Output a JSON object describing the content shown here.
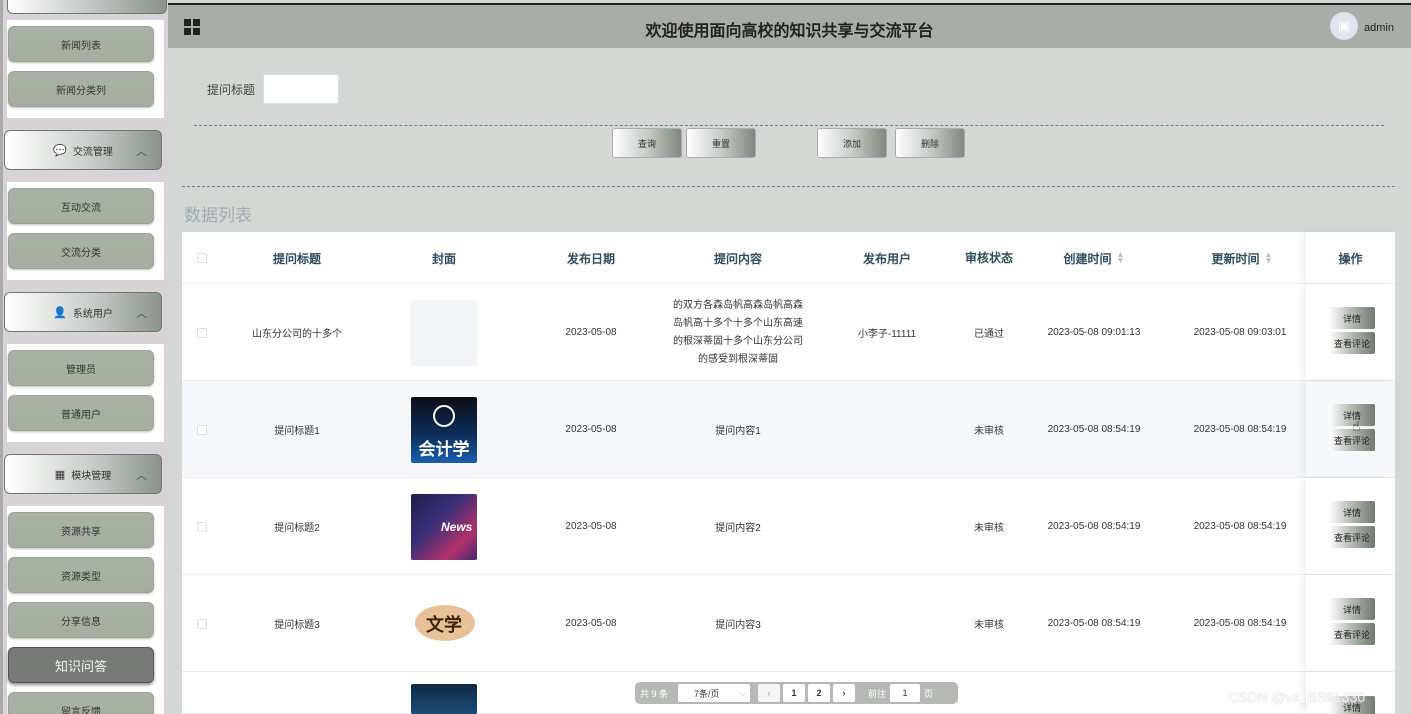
{
  "sidebar": {
    "top_items": [
      "新闻列表",
      "新闻分类列"
    ],
    "groups": [
      {
        "header": "交流管理",
        "items": [
          "互动交流",
          "交流分类"
        ]
      },
      {
        "header": "系统用户",
        "items": [
          "管理员",
          "普通用户"
        ]
      },
      {
        "header": "模块管理",
        "items": [
          "资源共享",
          "资源类型",
          "分享信息",
          "知识问答",
          "留言反馈"
        ]
      }
    ],
    "active_item": "知识问答"
  },
  "topbar": {
    "title": "欢迎使用面向高校的知识共享与交流平台",
    "user": "admin"
  },
  "search": {
    "label": "提问标题",
    "value": ""
  },
  "actions": {
    "query": "查询",
    "reset": "重置",
    "add": "添加",
    "delete": "删除"
  },
  "list_title": "数据列表",
  "table": {
    "headers": [
      "提问标题",
      "封面",
      "发布日期",
      "提问内容",
      "发布用户",
      "审核状态",
      "创建时间",
      "更新时间",
      "操作"
    ],
    "rows": [
      {
        "title": "山东分公司的十多个",
        "cover": "blank",
        "date": "2023-05-08",
        "content": "的双方各森岛帆高森岛帆高森岛帆高十多个十多个山东高速的根深蒂固十多个山东分公司的感受到根深蒂固",
        "user": "小李子-11111",
        "status": "已通过",
        "created": "2023-05-08 09:01:13",
        "updated": "2023-05-08 09:03:01"
      },
      {
        "title": "提问标题1",
        "cover": "accounting",
        "cover_text": "会计学",
        "date": "2023-05-08",
        "content": "提问内容1",
        "user": "",
        "status": "未审核",
        "created": "2023-05-08 08:54:19",
        "updated": "2023-05-08 08:54:19"
      },
      {
        "title": "提问标题2",
        "cover": "news",
        "cover_text": "News",
        "date": "2023-05-08",
        "content": "提问内容2",
        "user": "",
        "status": "未审核",
        "created": "2023-05-08 08:54:19",
        "updated": "2023-05-08 08:54:19"
      },
      {
        "title": "提问标题3",
        "cover": "literature",
        "cover_text": "文学",
        "date": "2023-05-08",
        "content": "提问内容3",
        "user": "",
        "status": "未审核",
        "created": "2023-05-08 08:54:19",
        "updated": "2023-05-08 08:54:19"
      }
    ],
    "row_buttons": {
      "detail": "详情",
      "comments": "查看评论"
    }
  },
  "pagination": {
    "total": "共 9 条",
    "page_size": "7条/页",
    "pages": [
      "1",
      "2"
    ],
    "goto_label": "前往",
    "goto_value": "1",
    "page_unit": "页"
  },
  "watermark": "CSDN @vx_BS81330"
}
